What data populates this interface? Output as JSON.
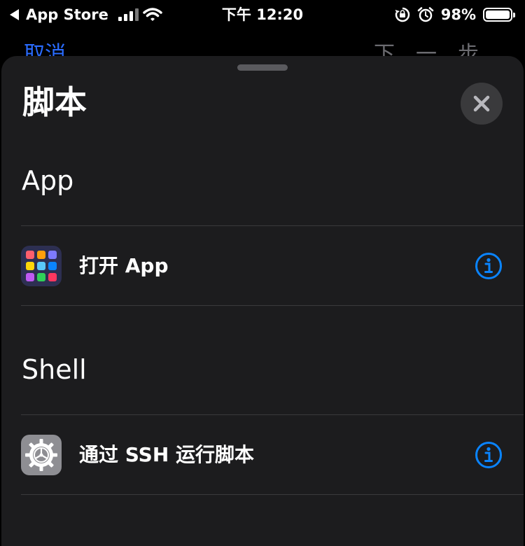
{
  "status_bar": {
    "back_label": "App Store",
    "time": "下午 12:20",
    "battery": "98%"
  },
  "behind": {
    "left": "取消",
    "right": "下一步"
  },
  "sheet": {
    "title": "脚本",
    "sections": [
      {
        "header": "App",
        "items": [
          {
            "label": "打开 App",
            "icon": "app-grid-icon"
          }
        ]
      },
      {
        "header": "Shell",
        "items": [
          {
            "label": "通过 SSH 运行脚本",
            "icon": "gear-icon"
          }
        ]
      }
    ]
  },
  "colors": {
    "accent": "#0a84ff",
    "sheet_bg": "#1c1c1e",
    "divider": "#3a3a3c",
    "close_bg": "#3a3a3c"
  }
}
